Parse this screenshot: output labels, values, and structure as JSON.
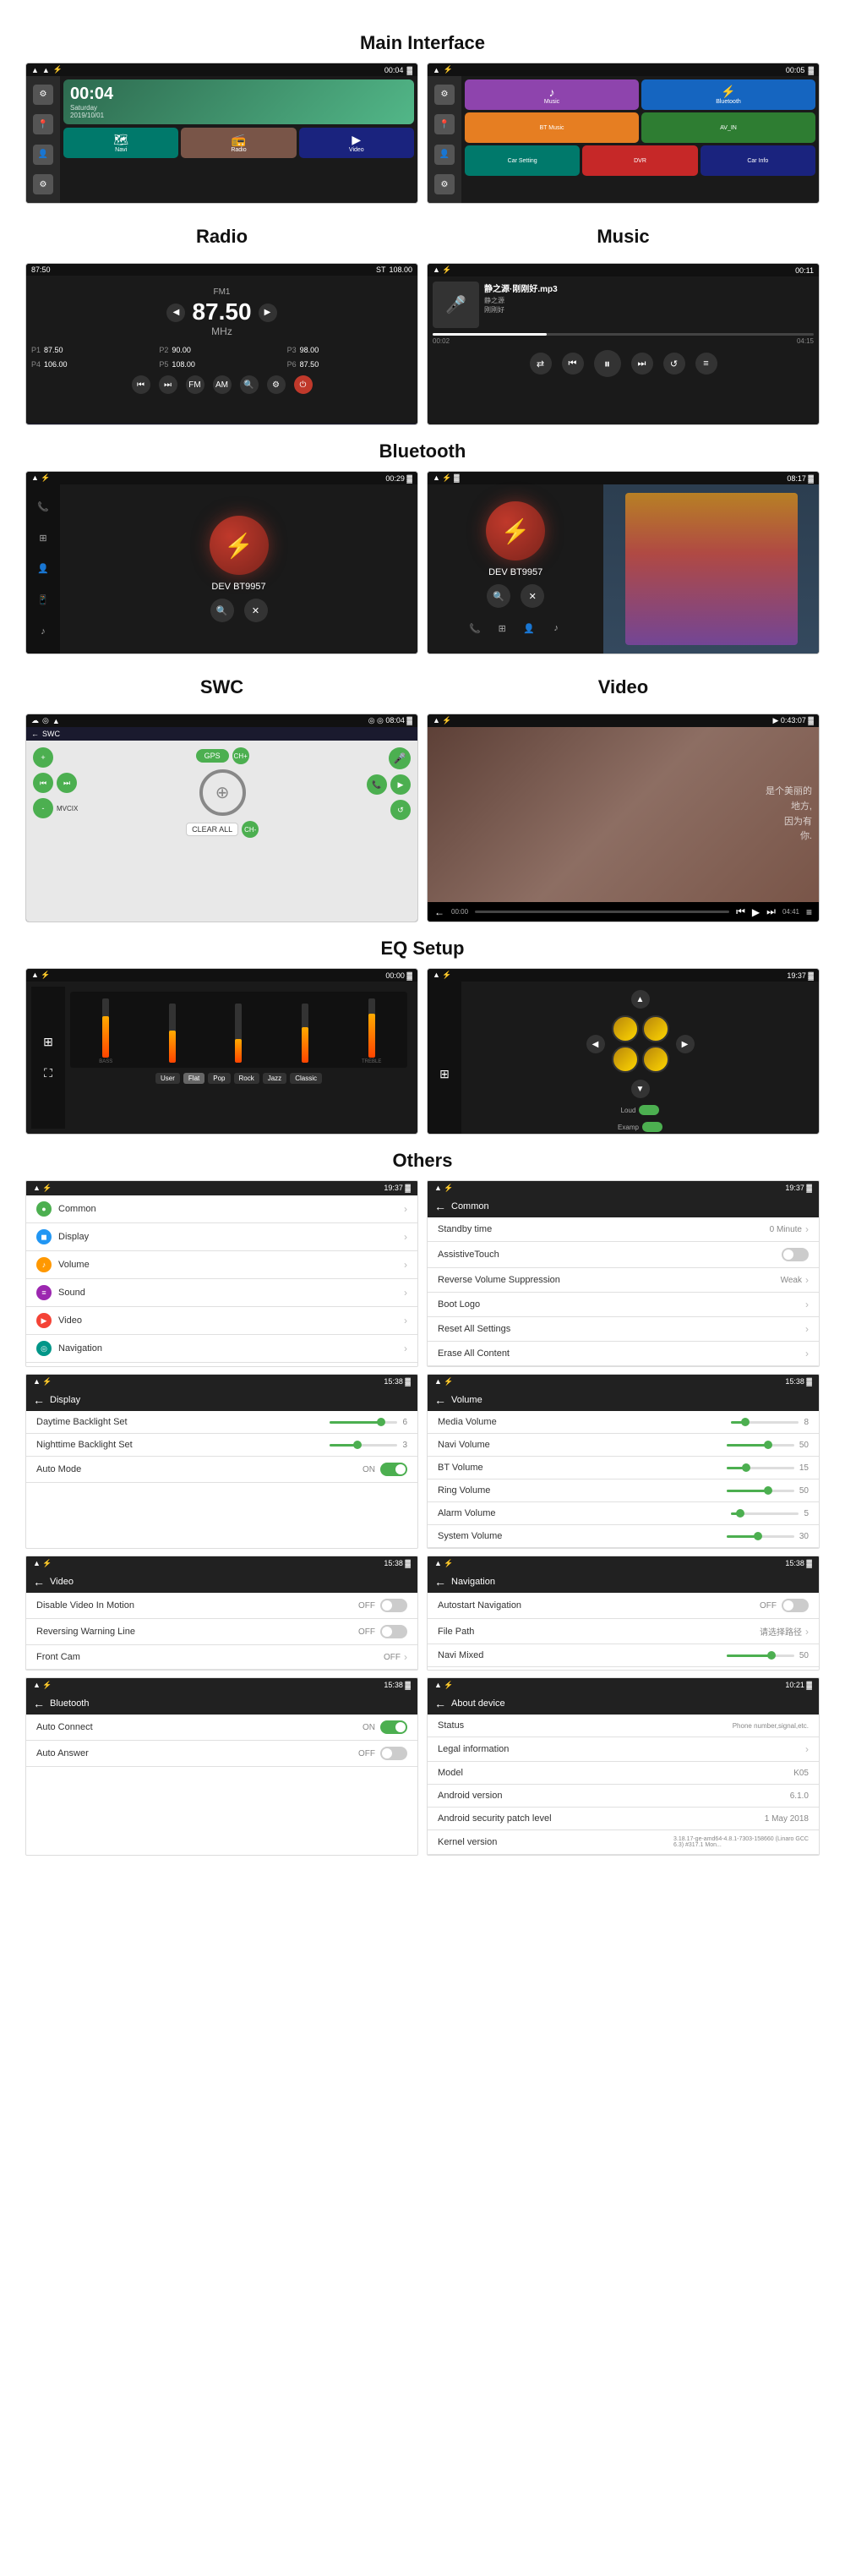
{
  "page": {
    "title": "Main Interface"
  },
  "sections": {
    "main_interface": {
      "label": "Main Interface"
    },
    "radio": {
      "label": "Radio"
    },
    "music": {
      "label": "Music"
    },
    "bluetooth": {
      "label": "Bluetooth"
    },
    "swc": {
      "label": "SWC"
    },
    "video": {
      "label": "Video"
    },
    "eq_setup": {
      "label": "EQ Setup"
    },
    "others": {
      "label": "Others"
    }
  },
  "main_interface": {
    "clock": "00:04",
    "day": "Saturday",
    "date": "2019/10/01",
    "apps_left": [
      "🎵",
      "📻",
      "🎬"
    ],
    "app_labels_left": [
      "Navi",
      "Radio",
      "Video"
    ],
    "apps_right_top": [
      "♪",
      "Bluetooth"
    ],
    "apps_right_mid": [
      "BT Music",
      "AV_IN"
    ],
    "apps_right_bottom": [
      "Car Setting",
      "DVR",
      "Car Info"
    ]
  },
  "radio": {
    "band": "FM1",
    "freq": "87.50",
    "unit": "MHz",
    "st_label": "ST",
    "freq_right": "108.00",
    "presets": [
      {
        "label": "P1",
        "val": "87.50"
      },
      {
        "label": "P2",
        "val": "90.00"
      },
      {
        "label": "P3",
        "val": "98.00"
      },
      {
        "label": "P4",
        "val": "106.00"
      },
      {
        "label": "P5",
        "val": "108.00"
      },
      {
        "label": "P6",
        "val": "87.50"
      }
    ],
    "modes": [
      "FM",
      "AM"
    ]
  },
  "music": {
    "title": "静之源·刚刚好.mp3",
    "artist": "静之源",
    "album": "刚刚好",
    "time_current": "00:02",
    "time_total": "04:15"
  },
  "bluetooth": {
    "device": "DEV BT9957"
  },
  "swc": {
    "title": "SWC",
    "gps_label": "GPS",
    "ch_plus": "CH+",
    "ch_minus": "CH-",
    "clear_all": "CLEAR ALL",
    "mic_label": "🎤"
  },
  "video": {
    "text_overlay": [
      "是个美丽的",
      "地方,",
      "因为有",
      "你."
    ],
    "time": "04:41"
  },
  "eq": {
    "bands": [
      "BASS",
      "",
      "",
      "",
      "TREBLE"
    ],
    "heights_percent": [
      70,
      55,
      40,
      60,
      75
    ],
    "presets": [
      "User",
      "Flat",
      "Pop",
      "Rock",
      "Jazz",
      "Classic"
    ],
    "active_preset": "Flat",
    "loud_label": "Loud",
    "examp_label": "Examp"
  },
  "others": {
    "settings_items": [
      {
        "icon": "●",
        "icon_class": "green",
        "label": "Common"
      },
      {
        "icon": "◼",
        "icon_class": "blue",
        "label": "Display"
      },
      {
        "icon": "♪",
        "icon_class": "orange",
        "label": "Volume"
      },
      {
        "icon": "≡",
        "icon_class": "purple",
        "label": "Sound"
      },
      {
        "icon": "▶",
        "icon_class": "red",
        "label": "Video"
      },
      {
        "icon": "◎",
        "icon_class": "teal",
        "label": "Navigation"
      }
    ],
    "common_items": [
      {
        "label": "Standby time",
        "value": "0 Minute",
        "type": "arrow"
      },
      {
        "label": "AssistiveTouch",
        "value": "OFF",
        "type": "toggle-off"
      },
      {
        "label": "Reverse Volume Suppression",
        "value": "Weak",
        "type": "arrow"
      },
      {
        "label": "Boot Logo",
        "value": "",
        "type": "arrow"
      },
      {
        "label": "Reset All Settings",
        "value": "",
        "type": "arrow"
      },
      {
        "label": "Erase All Content",
        "value": "",
        "type": "arrow"
      }
    ],
    "display_items": [
      {
        "label": "Daytime Backlight Set",
        "value": "6",
        "slider_pct": 75
      },
      {
        "label": "Nighttime Backlight Set",
        "value": "3",
        "slider_pct": 40
      },
      {
        "label": "Auto Mode",
        "value": "ON",
        "type": "toggle-on"
      }
    ],
    "volume_items": [
      {
        "label": "Media Volume",
        "value": "8",
        "slider_pct": 20
      },
      {
        "label": "Navi Volume",
        "value": "50",
        "slider_pct": 60
      },
      {
        "label": "BT Volume",
        "value": "15",
        "slider_pct": 28
      },
      {
        "label": "Ring Volume",
        "value": "50",
        "slider_pct": 60
      },
      {
        "label": "Alarm Volume",
        "value": "5",
        "slider_pct": 12
      },
      {
        "label": "System Volume",
        "value": "30",
        "slider_pct": 45
      }
    ],
    "video_settings": [
      {
        "label": "Disable Video In Motion",
        "value": "OFF",
        "type": "toggle-off"
      },
      {
        "label": "Reversing Warning Line",
        "value": "OFF",
        "type": "toggle-off"
      },
      {
        "label": "Front Cam",
        "value": "OFF",
        "type": "arrow"
      }
    ],
    "navigation_items": [
      {
        "label": "Autostart Navigation",
        "value": "OFF",
        "type": "toggle-off"
      },
      {
        "label": "File Path",
        "value": "请选择路径",
        "type": "arrow"
      },
      {
        "label": "Navi Mixed",
        "value": "50",
        "slider_pct": 65
      }
    ],
    "bluetooth_settings": [
      {
        "label": "Auto Connect",
        "value": "ON",
        "type": "toggle-on"
      },
      {
        "label": "Auto Answer",
        "value": "OFF",
        "type": "toggle-off"
      }
    ],
    "about_device": {
      "title": "About device",
      "items": [
        {
          "label": "Status",
          "value": "Phone number,signal,etc."
        },
        {
          "label": "Legal information",
          "value": ""
        },
        {
          "label": "Model",
          "value": "K05"
        },
        {
          "label": "Android version",
          "value": "6.1.0"
        },
        {
          "label": "Android security patch level",
          "value": "1 May 2018"
        },
        {
          "label": "Kernel version",
          "value": "3.18.17-ge-amd64-4.8.1-7303-158660 (Linaro GCC 6.3) #317.1 Mon..."
        }
      ]
    }
  },
  "ui": {
    "back_arrow": "←",
    "chevron_right": "›",
    "play_icon": "▶",
    "pause_icon": "⏸",
    "prev_icon": "⏮",
    "next_icon": "⏭",
    "mic_icon": "🎤",
    "bt_icon": "⚡",
    "gear_icon": "⚙",
    "location_pin": "📍"
  }
}
